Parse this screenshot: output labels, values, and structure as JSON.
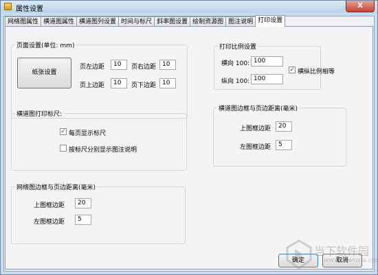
{
  "window": {
    "title": "属性设置",
    "close_glyph": "X"
  },
  "tabs": [
    "网络图属性",
    "横道图属性",
    "横道图列设置",
    "时间与标尺",
    "斜率图设置",
    "绘制资源图",
    "图注说明",
    "打印设置"
  ],
  "active_tab": "打印设置",
  "page_setup": {
    "title": "页面设置(单位: mm)",
    "paper_button": "纸张设置",
    "left_margin_label": "页左边距",
    "left_margin": "10",
    "right_margin_label": "页右边距",
    "right_margin": "10",
    "top_margin_label": "页上边距",
    "top_margin": "10",
    "bottom_margin_label": "页下边距",
    "bottom_margin": "10"
  },
  "scale": {
    "title": "打印比例设置",
    "horizontal_label": "横向 100:",
    "horizontal": "100",
    "vertical_label": "纵向 100:",
    "vertical": "100",
    "equal_label": "横纵比例相等",
    "equal_checked": "✓"
  },
  "ruler": {
    "title": "横道图打印标尺:",
    "each_page_label": "每页显示标尺",
    "each_page_checked": "✓",
    "separate_label": "按标尺分别显示图注说明",
    "separate_checked": ""
  },
  "network_border": {
    "title": "网络图边框与页边距离(毫米)",
    "top_label": "上图框边距",
    "top": "20",
    "left_label": "左图框边距",
    "left": "5"
  },
  "gantt_border": {
    "title": "横道图边框与页边距离(毫米)",
    "top_label": "上图框边距",
    "top": "20",
    "left_label": "左图框边距",
    "left": "5"
  },
  "buttons": {
    "ok": "确定",
    "cancel": "取消"
  },
  "watermark": {
    "text": "当下软件园",
    "url": "www.downxia.com"
  }
}
